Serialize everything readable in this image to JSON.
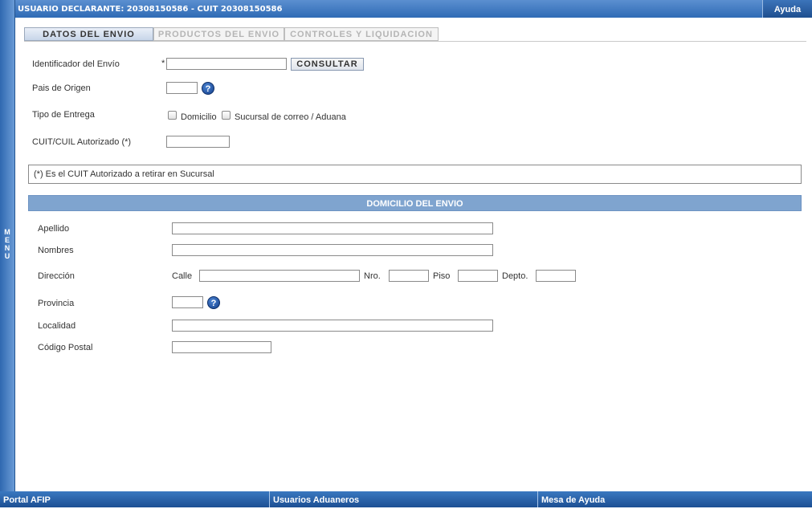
{
  "header": {
    "user": "USUARIO DECLARANTE: 20308150586 - CUIT 20308150586",
    "help": "Ayuda"
  },
  "side_menu": {
    "label": "MENU"
  },
  "tabs": [
    {
      "label": "DATOS DEL ENVIO",
      "active": true
    },
    {
      "label": "PRODUCTOS DEL ENVIO",
      "active": false
    },
    {
      "label": "CONTROLES Y LIQUIDACION",
      "active": false
    }
  ],
  "form": {
    "identificador_label": "Identificador del Envío",
    "required_mark": "*",
    "identificador_value": "",
    "consultar_label": "CONSULTAR",
    "pais_label": "Pais de Origen",
    "pais_value": "",
    "tipo_entrega_label": "Tipo de Entrega",
    "domicilio_label": "Domicilio",
    "sucursal_label": "Sucursal de correo / Aduana",
    "cuit_label": "CUIT/CUIL Autorizado (*)",
    "cuit_value": "",
    "note": "(*) Es el CUIT Autorizado a retirar en Sucursal"
  },
  "domicilio": {
    "section_title": "DOMICILIO DEL ENVIO",
    "apellido_label": "Apellido",
    "nombres_label": "Nombres",
    "direccion_label": "Dirección",
    "calle_label": "Calle",
    "nro_label": "Nro.",
    "piso_label": "Piso",
    "depto_label": "Depto.",
    "provincia_label": "Provincia",
    "localidad_label": "Localidad",
    "codigo_postal_label": "Código Postal"
  },
  "help_icon_glyph": "?",
  "footer": {
    "portal": "Portal AFIP",
    "usuarios": "Usuarios Aduaneros",
    "mesa": "Mesa de Ayuda"
  },
  "colors": {
    "header_blue": "#2f6bb5",
    "section_blue": "#7fa4cf"
  }
}
